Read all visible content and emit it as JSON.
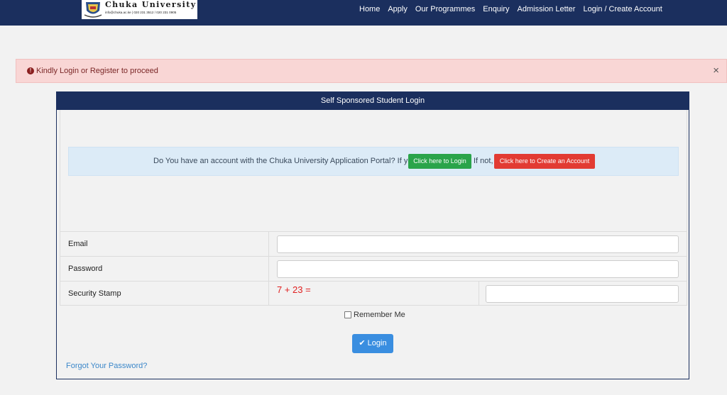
{
  "brand": {
    "name": "Chuka University",
    "contact": "info@chuka.ac.ke | 020 231 3512 / 020 231 0905"
  },
  "nav": {
    "items": [
      "Home",
      "Apply",
      "Our Programmes",
      "Enquiry",
      "Admission Letter",
      "Login / Create Account"
    ]
  },
  "alert": {
    "message": "Kindly Login or Register to proceed",
    "icon": "exclamation-circle-icon",
    "close": "×"
  },
  "panel": {
    "title": "Self Sponsored Student Login"
  },
  "info": {
    "question": "Do You have an account with the Chuka University Application Portal? If yes,",
    "login_button": "Click here to Login",
    "if_not": "If not,",
    "create_button": "Click here to Create an Account"
  },
  "form": {
    "email_label": "Email",
    "email_value": "",
    "password_label": "Password",
    "password_value": "",
    "security_label": "Security Stamp",
    "captcha": "7 + 23 =",
    "security_value": "",
    "remember_label": "Remember Me",
    "remember_checked": false,
    "login_button": "Login",
    "forgot_link": "Forgot Your Password?"
  },
  "colors": {
    "navbar": "#1b2f5e",
    "alert_bg": "#f9d6d5",
    "success_button": "#2aa44a",
    "danger_button": "#e23b33",
    "primary_button": "#3a8ee0",
    "captcha_text": "#e02020",
    "link": "#3b87c9"
  }
}
